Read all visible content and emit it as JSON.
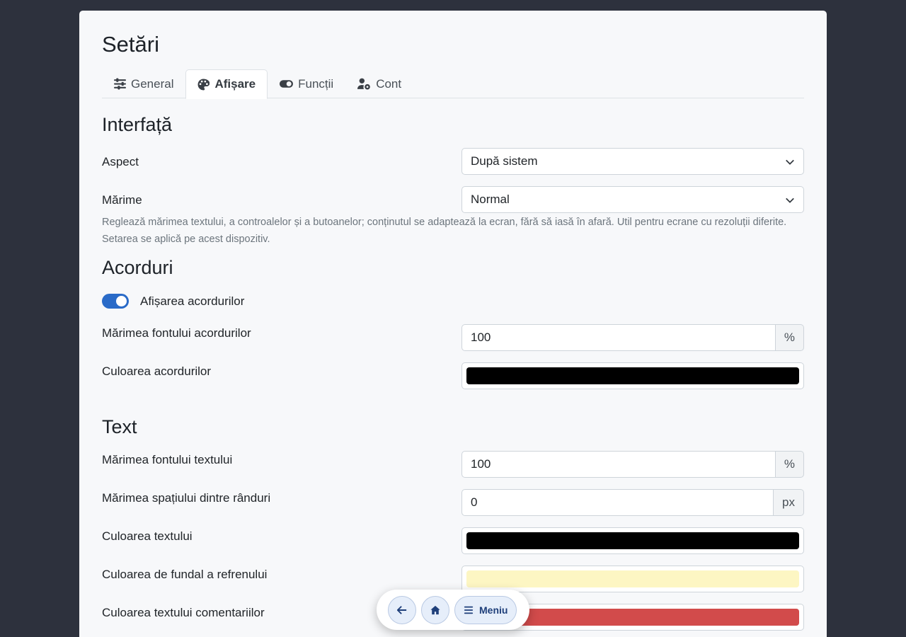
{
  "page": {
    "title": "Setări"
  },
  "tabs": [
    {
      "label": "General",
      "icon": "sliders-icon",
      "active": false
    },
    {
      "label": "Afișare",
      "icon": "palette-icon",
      "active": true
    },
    {
      "label": "Funcții",
      "icon": "toggle-icon",
      "active": false
    },
    {
      "label": "Cont",
      "icon": "user-gear-icon",
      "active": false
    }
  ],
  "interface": {
    "heading": "Interfață",
    "appearance": {
      "label": "Aspect",
      "value": "După sistem"
    },
    "size": {
      "label": "Mărime",
      "value": "Normal",
      "help_1": "Reglează mărimea textului, a controalelor și a butoanelor; conținutul se adaptează la ecran, fără să iasă în afară. Util pentru ecrane cu rezoluții diferite.",
      "help_2": "Setarea se aplică pe acest dispozitiv."
    }
  },
  "chords": {
    "heading": "Acorduri",
    "show": {
      "label": "Afișarea acordurilor",
      "enabled": true
    },
    "font_size": {
      "label": "Mărimea fontului acordurilor",
      "value": "100",
      "unit": "%"
    },
    "color": {
      "label": "Culoarea acordurilor",
      "value": "#000000"
    }
  },
  "text": {
    "heading": "Text",
    "font_size": {
      "label": "Mărimea fontului textului",
      "value": "100",
      "unit": "%"
    },
    "line_spacing": {
      "label": "Mărimea spațiului dintre rânduri",
      "value": "0",
      "unit": "px"
    },
    "color": {
      "label": "Culoarea textului",
      "value": "#000000"
    },
    "chorus_bg": {
      "label": "Culoarea de fundal a refrenului",
      "value": "#fdf6c3"
    },
    "comment_color": {
      "label": "Culoarea textului comentariilor",
      "value": "#d24b4b"
    }
  },
  "floatbar": {
    "back_icon": "arrow-left-icon",
    "home_icon": "home-icon",
    "menu_icon": "bars-icon",
    "menu_label": "Meniu"
  }
}
